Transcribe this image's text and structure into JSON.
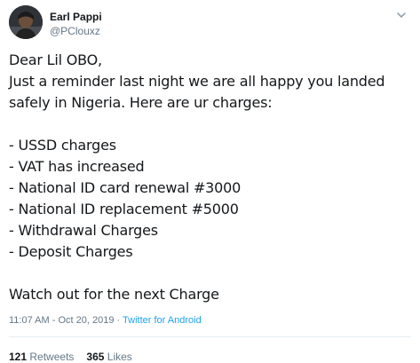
{
  "author": {
    "display_name": "Earl Pappi",
    "handle": "@PClouxz",
    "avatar": "profile-photo"
  },
  "tweet": {
    "lines": [
      "Dear Lil OBO,",
      "Just a reminder last night we are all happy you landed",
      "safely in Nigeria. Here are ur charges:",
      "",
      "- USSD charges",
      "- VAT has increased",
      "- National ID card renewal #3000",
      "- National ID replacement #5000",
      "- Withdrawal Charges",
      "- Deposit Charges",
      "",
      "Watch out for the next Charge"
    ]
  },
  "meta": {
    "time": "11:07 AM",
    "separator": " - ",
    "date": "Oct 20, 2019",
    "dot": " · ",
    "source": "Twitter for Android"
  },
  "stats": {
    "retweets_count": "121",
    "retweets_label": "Retweets",
    "likes_count": "365",
    "likes_label": "Likes"
  },
  "colors": {
    "text": "#14171a",
    "secondary": "#657786",
    "link": "#1da1f2",
    "divider": "#e6ecf0"
  },
  "icons": {
    "caret": "chevron-down-icon"
  }
}
